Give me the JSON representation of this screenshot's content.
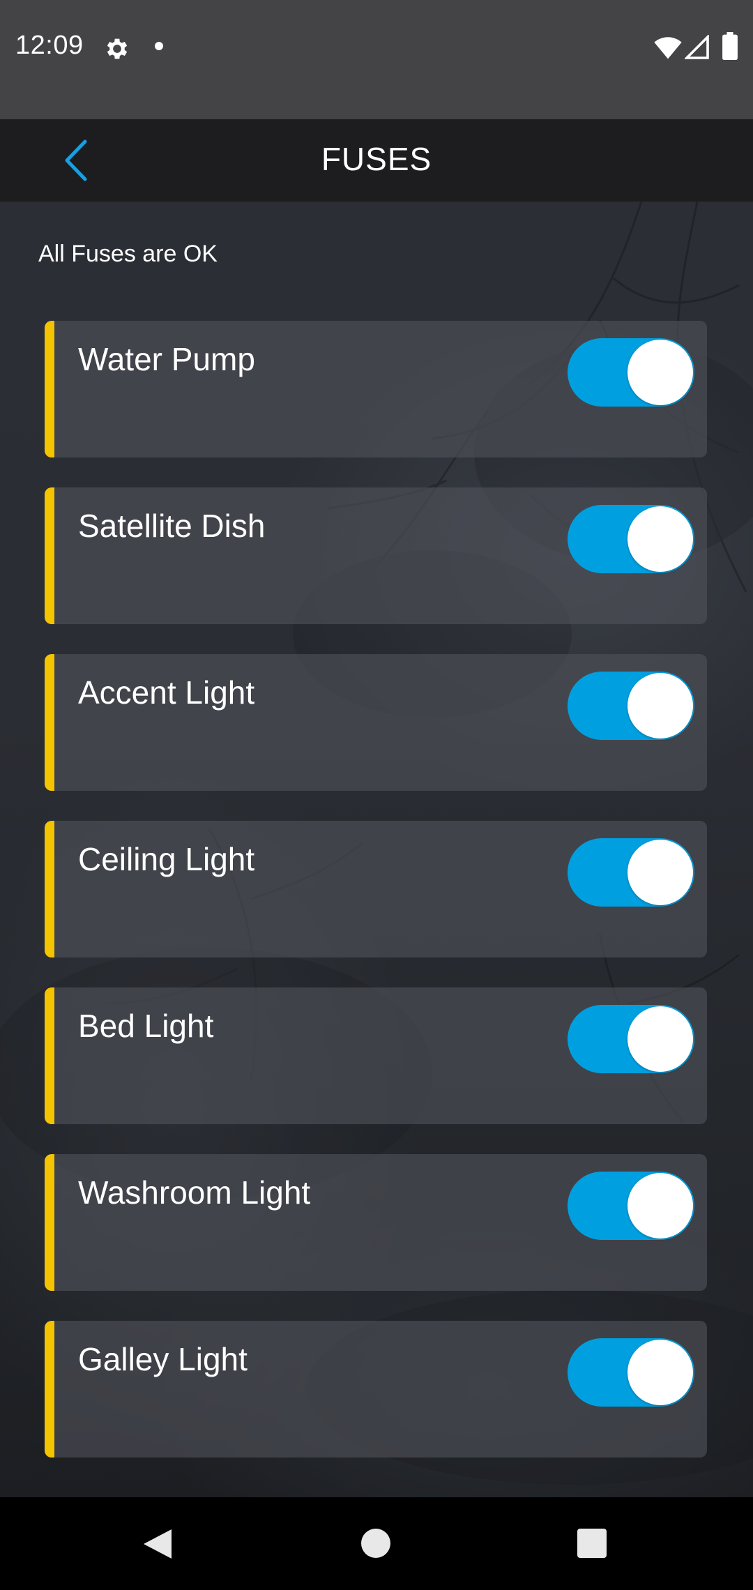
{
  "status_bar": {
    "time": "12:09",
    "icons": [
      "gear-icon",
      "notification-dot-icon",
      "wifi-icon",
      "cell-signal-icon",
      "battery-icon"
    ]
  },
  "header": {
    "title": "FUSES",
    "back_icon": "chevron-left-icon"
  },
  "status_message": "All Fuses are OK",
  "fuses": [
    {
      "label": "Water Pump",
      "on": true
    },
    {
      "label": "Satellite Dish",
      "on": true
    },
    {
      "label": "Accent Light",
      "on": true
    },
    {
      "label": "Ceiling Light",
      "on": true
    },
    {
      "label": "Bed Light",
      "on": true
    },
    {
      "label": "Washroom Light",
      "on": true
    },
    {
      "label": "Galley Light",
      "on": true
    }
  ],
  "colors": {
    "accent": "#f5c400",
    "toggle_on": "#00a0e0",
    "back_chevron": "#1a9fe0"
  },
  "nav_bar": {
    "icons": [
      "nav-back-icon",
      "nav-home-icon",
      "nav-recents-icon"
    ]
  }
}
